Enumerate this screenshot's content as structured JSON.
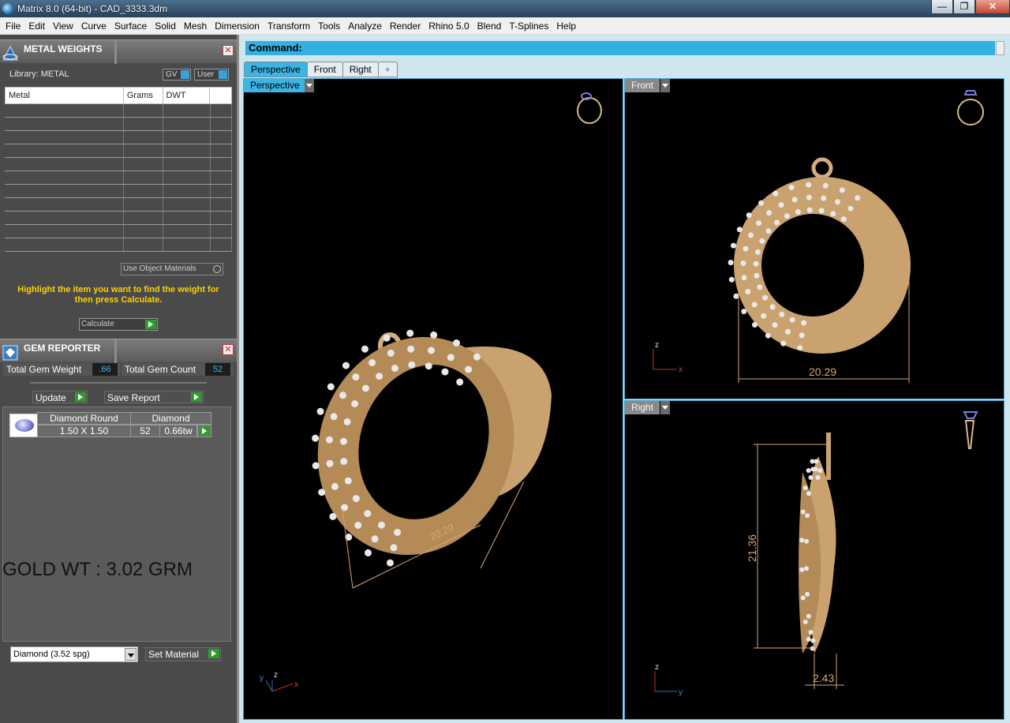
{
  "window": {
    "title": "Matrix 8.0 (64-bit) - CAD_3333.3dm",
    "minimize": "—",
    "maximize": "❐",
    "close": "✕"
  },
  "menu": [
    "File",
    "Edit",
    "View",
    "Curve",
    "Surface",
    "Solid",
    "Mesh",
    "Dimension",
    "Transform",
    "Tools",
    "Analyze",
    "Render",
    "Rhino 5.0",
    "Blend",
    "T-Splines",
    "Help"
  ],
  "metal_weights": {
    "title": "METAL WEIGHTS",
    "library": "Library: METAL",
    "gv": "GV",
    "user": "User",
    "columns": [
      "Metal",
      "Grams",
      "DWT"
    ],
    "use_object_materials": "Use Object Materials",
    "hint": "Highlight the item you want to find the weight for then press Calculate.",
    "calculate": "Calculate"
  },
  "gem_reporter": {
    "title": "GEM REPORTER",
    "total_weight_label": "Total Gem Weight",
    "total_weight_value": ".66",
    "total_count_label": "Total Gem Count",
    "total_count_value": "52",
    "update": "Update",
    "save_report": "Save Report",
    "gem_name": "Diamond Round",
    "gem_type": "Diamond",
    "gem_size": "1.50 X 1.50",
    "gem_count": "52",
    "gem_weight": "0.66tw",
    "gold_wt": "GOLD WT : 3.02 GRM",
    "material_select": "Diamond    (3.52 spg)",
    "set_material": "Set Material"
  },
  "command": {
    "label": "Command:"
  },
  "tabs": [
    "Perspective",
    "Front",
    "Right",
    "+"
  ],
  "viewports": {
    "perspective": {
      "label": "Perspective",
      "dimension": "20.29"
    },
    "front": {
      "label": "Front",
      "dimension": "20.29"
    },
    "right": {
      "label": "Right",
      "dimension_height": "21.36",
      "dimension_depth": "2.43"
    }
  },
  "axes": {
    "x": "x",
    "y": "y",
    "z": "z"
  },
  "colors": {
    "accent": "#3cb4e4",
    "gold": "#d9b88a",
    "hint": "#ffd200",
    "dimension": "#d9a773"
  }
}
